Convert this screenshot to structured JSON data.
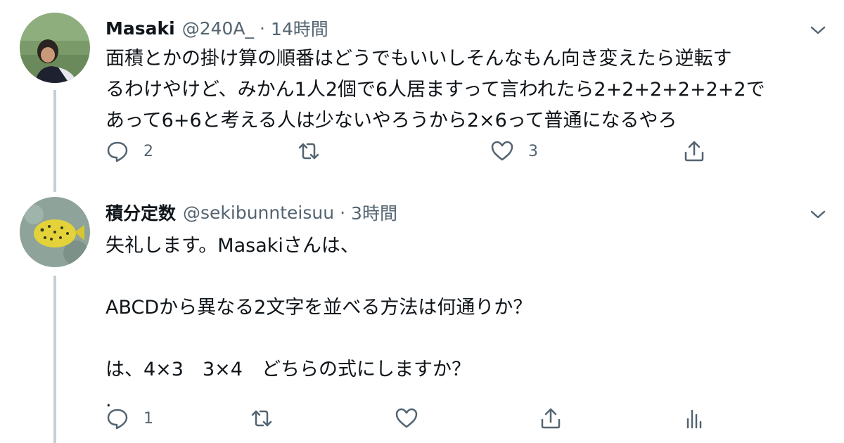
{
  "tweets": [
    {
      "name": "Masaki",
      "handle": "@240A_",
      "separator": "·",
      "time": "14時間",
      "text": "面積とかの掛け算の順番はどうでもいいしそんなもん向き変えたら逆転す\nるわけやけど、みかん1人2個で6人居ますって言われたら2+2+2+2+2+2で\nあって6+6と考える人は少ないやろうから2×6って普通になるやろ",
      "reply_count": "2",
      "retweet_count": "",
      "like_count": "3",
      "avatar_icon": "person-photo-avatar",
      "menu_icon": "chevron-down-icon"
    },
    {
      "name": "積分定数",
      "handle": "@sekibunnteisuu",
      "separator": "·",
      "time": "3時間",
      "text": "失礼します。Masakiさんは、\n\nABCDから異なる2文字を並べる方法は何通りか？\n\nは、4×3　3×4　どちらの式にしますか？\n.",
      "reply_count": "1",
      "retweet_count": "",
      "like_count": "",
      "avatar_icon": "boxfish-photo-avatar",
      "menu_icon": "chevron-down-icon"
    }
  ],
  "colors": {
    "text": "#0f1419",
    "secondary": "#536471",
    "thread_line": "#c4cfd6"
  }
}
